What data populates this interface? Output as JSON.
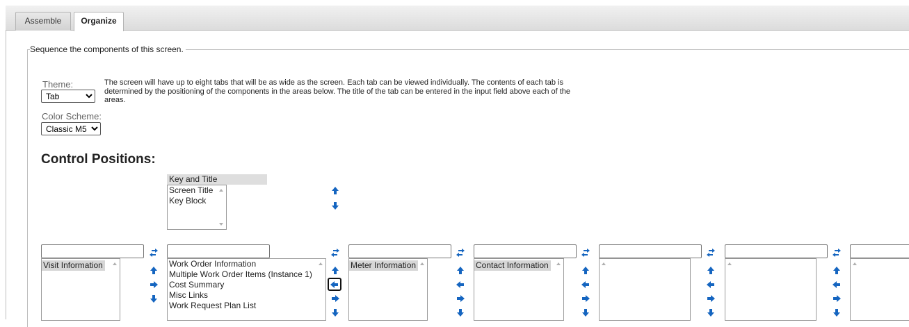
{
  "tabs": [
    {
      "label": "Assemble",
      "active": false
    },
    {
      "label": "Organize",
      "active": true
    }
  ],
  "section_legend": "Sequence the components of this screen.",
  "theme": {
    "label": "Theme:",
    "selected": "Tab"
  },
  "color_scheme": {
    "label": "Color Scheme:",
    "selected": "Classic M5"
  },
  "description": "The screen will have up to eight tabs that will be as wide as the screen. Each tab can be viewed individually. The contents of each tab is determined by the positioning of the components in the areas below. The title of the tab can be entered in the input field above each of the areas.",
  "control_positions_heading": "Control Positions:",
  "key_area": {
    "title": "Key and Title",
    "items": [
      "Screen Title",
      "Key Block"
    ]
  },
  "areas": [
    {
      "title_value": "",
      "items": [
        "Visit Information"
      ]
    },
    {
      "title_value": "",
      "items": [
        "Work Order Information",
        "Multiple Work Order Items (Instance 1)",
        "Cost Summary",
        "Misc Links",
        "Work Request Plan List"
      ]
    },
    {
      "title_value": "",
      "items": [
        "Meter Information"
      ]
    },
    {
      "title_value": "",
      "items": [
        "Contact Information"
      ]
    },
    {
      "title_value": "",
      "items": []
    },
    {
      "title_value": "",
      "items": []
    },
    {
      "title_value": "",
      "items": []
    }
  ],
  "colors": {
    "accent_blue": "#1565c0",
    "highlight": "#d6d6d6"
  },
  "icons": {
    "swap": "swap-arrows-icon",
    "up": "arrow-up-icon",
    "down": "arrow-down-icon",
    "left": "arrow-left-icon",
    "right": "arrow-right-icon"
  }
}
